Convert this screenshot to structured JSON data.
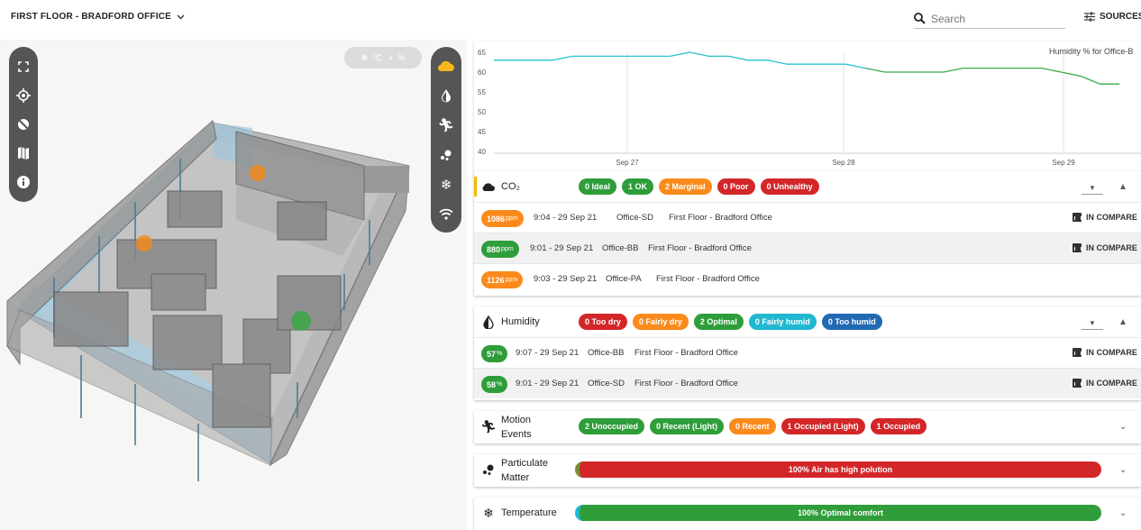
{
  "header": {
    "floor_label": "FIRST FLOOR - BRADFORD OFFICE",
    "search_placeholder": "Search",
    "sources_label": "SOURCES"
  },
  "view": {
    "layer_toggles": [
      "wind-icon",
      "celsius-icon",
      "drop-icon",
      "percent-icon"
    ],
    "left_tools": [
      "fullscreen-icon",
      "locate-icon",
      "no-location-icon",
      "map-icon",
      "info-icon"
    ],
    "right_tools": [
      "cloud-icon",
      "drop-icon",
      "motion-icon",
      "particulate-icon",
      "snowflake-icon",
      "wifi-icon"
    ],
    "sensor_colors": [
      "#f28a1e",
      "#f28a1e",
      "#3aa845"
    ]
  },
  "chart": {
    "title": "Humidity % for Office-B",
    "chart_data": {
      "type": "line",
      "title": "Humidity % for Office-B",
      "ylim": [
        40,
        65
      ],
      "yticks": [
        "65",
        "60",
        "55",
        "50",
        "45",
        "40"
      ],
      "xticks": [
        "Sep 27",
        "Sep 28",
        "Sep 29"
      ],
      "series": [
        {
          "color": "#27c3cf",
          "values": [
            63,
            63,
            63,
            63,
            64,
            64,
            64,
            64,
            64,
            64,
            65,
            64,
            64,
            63,
            63,
            62,
            62,
            62,
            62,
            61
          ]
        },
        {
          "color": "#3aa845",
          "values": [
            61,
            60,
            60,
            60,
            60,
            61,
            61,
            61,
            61,
            61,
            60,
            59,
            57,
            57
          ]
        }
      ]
    }
  },
  "co2": {
    "title": "CO₂",
    "chips": [
      "0 Ideal",
      "1 OK",
      "2 Marginal",
      "0 Poor",
      "0 Unhealthy"
    ],
    "rows": [
      {
        "value": "1086",
        "unit": "ppm",
        "time": "9:04 - 29 Sep 21",
        "sensor": "Office-SD",
        "location": "First Floor - Bradford Office",
        "compare": "IN COMPARE",
        "color": "#fb8a1c"
      },
      {
        "value": "880",
        "unit": "ppm",
        "time": "9:01 - 29 Sep 21",
        "sensor": "Office-BB",
        "location": "First Floor - Bradford Office",
        "compare": "IN COMPARE",
        "color": "#2e9d3a"
      },
      {
        "value": "1126",
        "unit": "ppm",
        "time": "9:03 - 29 Sep 21",
        "sensor": "Office-PA",
        "location": "First Floor - Bradford Office",
        "compare": "",
        "color": "#fb8a1c"
      }
    ]
  },
  "humidity": {
    "title": "Humidity",
    "chips": [
      "0 Too dry",
      "0 Fairly dry",
      "2 Optimal",
      "0 Fairly humid",
      "0 Too humid"
    ],
    "rows": [
      {
        "value": "57",
        "unit": "%",
        "time": "9:07 - 29 Sep 21",
        "sensor": "Office-BB",
        "location": "First Floor - Bradford Office",
        "compare": "IN COMPARE",
        "color": "#2e9d3a"
      },
      {
        "value": "58",
        "unit": "%",
        "time": "9:01 - 29 Sep 21",
        "sensor": "Office-SD",
        "location": "First Floor - Bradford Office",
        "compare": "IN COMPARE",
        "color": "#2e9d3a"
      }
    ]
  },
  "motion": {
    "title_line1": "Motion",
    "title_line2": "Events",
    "chips": [
      "2 Unoccupied",
      "0 Recent (Light)",
      "0 Recent",
      "1 Occupied (Light)",
      "1 Occupied"
    ]
  },
  "particulate": {
    "title_line1": "Particulate",
    "title_line2": "Matter",
    "bar_label": "100% Air has high polution",
    "fill": 1.0
  },
  "temperature": {
    "title": "Temperature",
    "bar_label": "100% Optimal comfort",
    "fill": 1.0
  }
}
